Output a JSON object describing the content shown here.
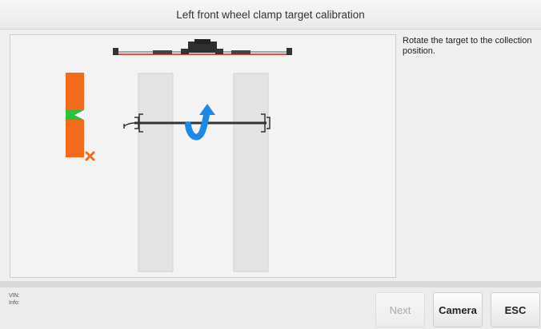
{
  "window": {
    "title": "Left front wheel clamp target calibration"
  },
  "instruction": {
    "text": "Rotate the target to the collection position."
  },
  "footer": {
    "vin_label": "VIN:",
    "info_label": "Info:",
    "buttons": {
      "next": "Next",
      "camera": "Camera",
      "esc": "ESC"
    },
    "next_enabled": false
  },
  "colors": {
    "target_orange": "#f26b1d",
    "target_green": "#2bbf3e",
    "rotate_arrow": "#1e88e5",
    "beam_red": "#e24c4c"
  }
}
